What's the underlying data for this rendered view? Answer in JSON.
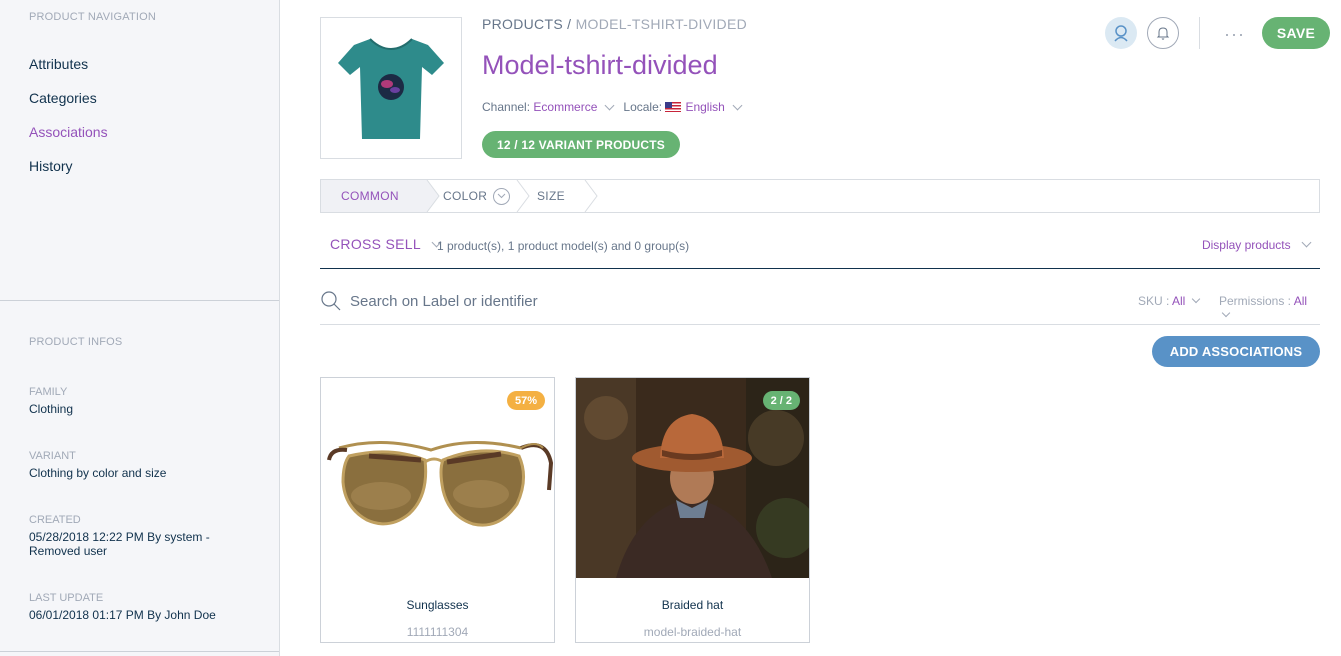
{
  "sidebar": {
    "nav_title": "PRODUCT NAVIGATION",
    "nav_items": [
      {
        "label": "Attributes"
      },
      {
        "label": "Categories"
      },
      {
        "label": "Associations",
        "active": true
      },
      {
        "label": "History"
      }
    ],
    "infos_title": "PRODUCT INFOS",
    "family": {
      "label": "FAMILY",
      "value": "Clothing"
    },
    "variant": {
      "label": "VARIANT",
      "value": "Clothing by color and size"
    },
    "created": {
      "label": "CREATED",
      "value": "05/28/2018 12:22 PM By system - Removed user"
    },
    "last_update": {
      "label": "LAST UPDATE",
      "value": "06/01/2018 01:17 PM By John Doe"
    }
  },
  "header": {
    "breadcrumb_root": "PRODUCTS",
    "breadcrumb_sep": "/",
    "breadcrumb_current": "MODEL-TSHIRT-DIVIDED",
    "title": "Model-tshirt-divided",
    "channel_label": "Channel:",
    "channel_value": "Ecommerce",
    "locale_label": "Locale:",
    "locale_value": "English",
    "variant_pill": "12 / 12 VARIANT PRODUCTS",
    "save_label": "SAVE",
    "more_label": "···"
  },
  "axes": [
    {
      "label": "COMMON"
    },
    {
      "label": "COLOR"
    },
    {
      "label": "SIZE"
    }
  ],
  "associations": {
    "type": "CROSS SELL",
    "summary": "1 product(s), 1 product model(s) and 0 group(s)",
    "display_label": "Display products"
  },
  "search": {
    "placeholder": "Search on Label or identifier",
    "sku_label": "SKU :",
    "sku_value": "All",
    "permissions_label": "Permissions :",
    "permissions_value": "All"
  },
  "add_associations_label": "ADD ASSOCIATIONS",
  "cards": [
    {
      "label": "Sunglasses",
      "identifier": "1111111304",
      "badge": "57%",
      "badge_color": "#f4b042"
    },
    {
      "label": "Braided hat",
      "identifier": "model-braided-hat",
      "badge": "2 / 2",
      "badge_color": "#67b373"
    }
  ],
  "colors": {
    "accent": "#9452ba",
    "green": "#67b373",
    "blue": "#5992c7"
  }
}
